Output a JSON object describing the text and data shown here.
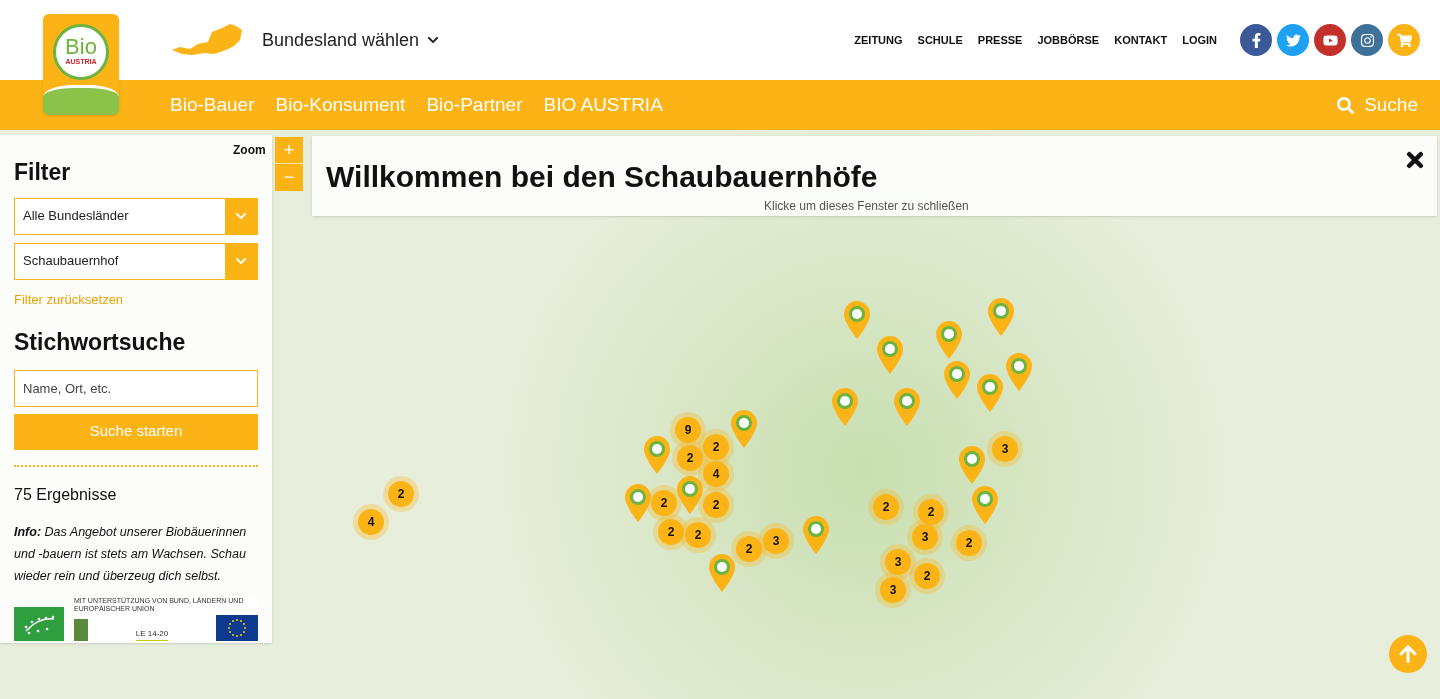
{
  "header": {
    "logo": {
      "top": "Bio",
      "bottom": "AUSTRIA"
    },
    "region_select": "Bundesland wählen",
    "top_links": [
      "ZEITUNG",
      "SCHULE",
      "PRESSE",
      "JOBBÖRSE",
      "KONTAKT",
      "LOGIN"
    ],
    "nav": [
      "Bio-Bauer",
      "Bio-Konsument",
      "Bio-Partner",
      "BIO AUSTRIA"
    ],
    "search": "Suche"
  },
  "filter": {
    "title": "Filter",
    "selects": [
      "Alle Bundesländer",
      "Schaubauernhof"
    ],
    "reset": "Filter zurücksetzen",
    "keyword_title": "Stichwortsuche",
    "keyword_placeholder": "Name, Ort, etc.",
    "search_button": "Suche starten",
    "results": "75 Ergebnisse",
    "info": "**Info:** Das Angebot unserer Biobäuerinnen und -bauern ist stets am Wachsen. Schau wieder rein und überzeug dich selbst.",
    "funding_note": "MIT UNTERSTÜTZUNG VON BUND, LÄNDERN UND EUROPÄISCHER UNION",
    "funding_logo": "LE 14-20"
  },
  "map": {
    "zoom_label": "Zoom",
    "zoom_in": "+",
    "zoom_out": "−",
    "welcome": {
      "title": "Willkommen bei den Schaubauernhöfe",
      "hint": "Klicke um dieses Fenster zu schließen"
    },
    "clusters": [
      "9",
      "2",
      "2",
      "4",
      "2",
      "2",
      "2",
      "2",
      "2",
      "3",
      "2",
      "4",
      "3",
      "2",
      "2",
      "3",
      "2",
      "3",
      "3",
      "2"
    ]
  }
}
